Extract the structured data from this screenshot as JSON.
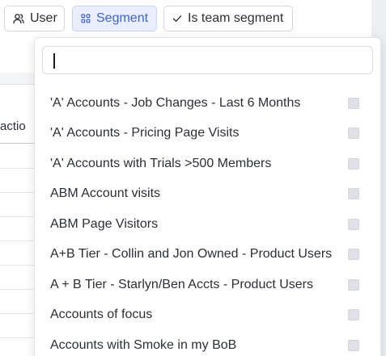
{
  "filters": {
    "user_label": "User",
    "segment_label": "Segment",
    "team_label": "Is team segment"
  },
  "background": {
    "column_label": "actio"
  },
  "dropdown": {
    "search_placeholder": "",
    "options": [
      "'A' Accounts - Job Changes - Last 6 Months",
      "'A' Accounts - Pricing Page Visits",
      "'A' Accounts with Trials >500 Members",
      "ABM Account visits",
      "ABM Page Visitors",
      "A+B Tier - Collin and Jon Owned - Product Users",
      "A + B Tier - Starlyn/Ben Accts - Product Users",
      "Accounts of focus",
      "Accounts with Smoke in my BoB"
    ]
  },
  "colors": {
    "segment_accent": "#3d63d9",
    "segment_bg": "#e9efff"
  },
  "icons": {
    "user": "user-icon",
    "segment": "grid-icon",
    "team": "check-icon"
  }
}
